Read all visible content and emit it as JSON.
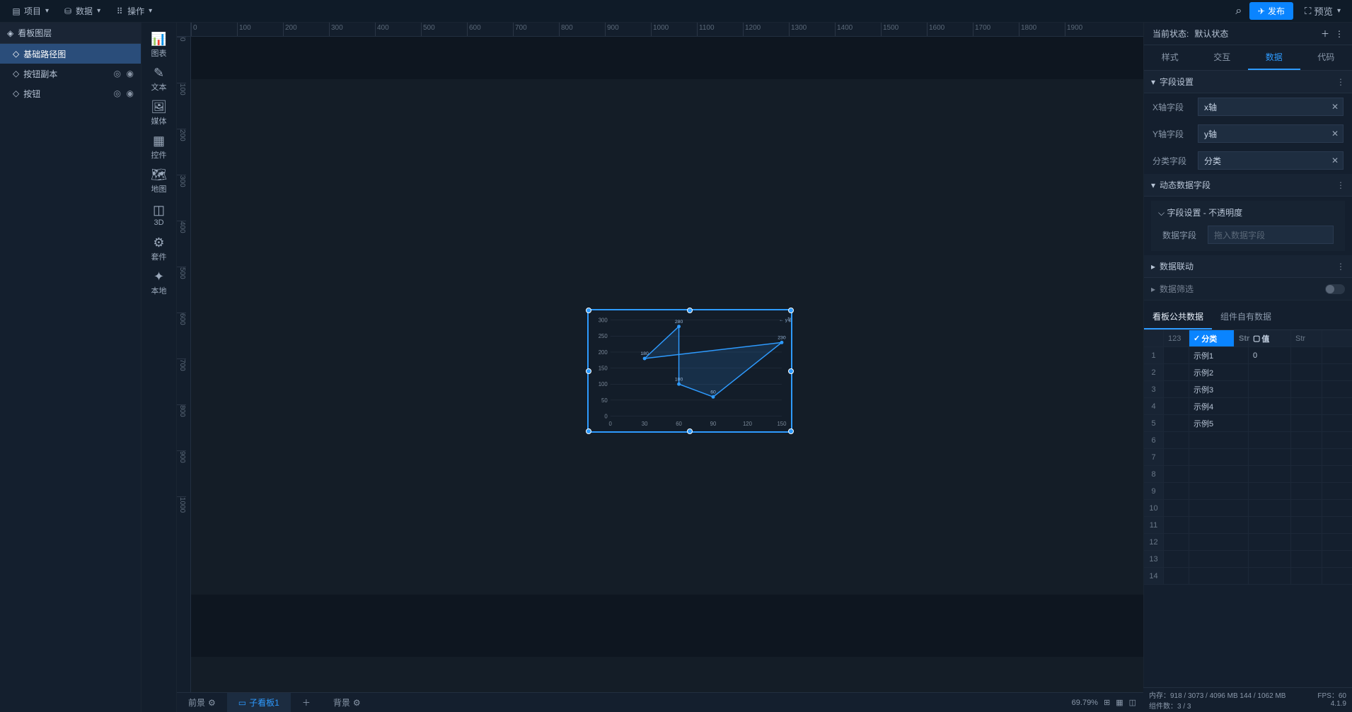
{
  "topMenu": {
    "project": "项目",
    "data": "数据",
    "operate": "操作"
  },
  "topRight": {
    "publish": "发布",
    "preview": "预览"
  },
  "leftPanel": {
    "title": "看板图层",
    "items": [
      {
        "label": "基础路径图",
        "active": true
      },
      {
        "label": "按钮副本",
        "active": false,
        "eye": true,
        "lock": true
      },
      {
        "label": "按钮",
        "active": false,
        "eye": true,
        "lock": true
      }
    ]
  },
  "compBar": [
    {
      "label": "图表",
      "icon": "📊"
    },
    {
      "label": "文本",
      "icon": "✎"
    },
    {
      "label": "媒体",
      "icon": "🖼"
    },
    {
      "label": "控件",
      "icon": "▦"
    },
    {
      "label": "地图",
      "icon": "🗺"
    },
    {
      "label": "3D",
      "icon": "◫"
    },
    {
      "label": "套件",
      "icon": "⚙"
    },
    {
      "label": "本地",
      "icon": "✦"
    }
  ],
  "ruler": {
    "h": [
      "0",
      "100",
      "200",
      "300",
      "400",
      "500",
      "600",
      "700",
      "800",
      "900",
      "1000",
      "1100",
      "1200",
      "1300",
      "1400",
      "1500",
      "1600",
      "1700",
      "1800",
      "1900"
    ],
    "v": [
      "0",
      "100",
      "200",
      "300",
      "400",
      "500",
      "600",
      "700",
      "800",
      "900",
      "1000"
    ]
  },
  "chart_data": {
    "type": "line",
    "series": [
      {
        "name": "y轴",
        "points": [
          {
            "x": 30,
            "y": 180
          },
          {
            "x": 60,
            "y": 280
          },
          {
            "x": 60,
            "y": 100
          },
          {
            "x": 90,
            "y": 60
          },
          {
            "x": 150,
            "y": 230
          }
        ]
      }
    ],
    "xlabel": "",
    "ylabel": "",
    "xticks": [
      0,
      30,
      60,
      90,
      120,
      150
    ],
    "yticks": [
      0,
      50,
      100,
      150,
      200,
      250,
      300
    ],
    "legend": "y轴"
  },
  "rightPanel": {
    "stateLabel": "当前状态:",
    "stateValue": "默认状态",
    "tabs": [
      "样式",
      "交互",
      "数据",
      "代码"
    ],
    "activeTab": 2,
    "fieldSection": "字段设置",
    "xAxisLabel": "X轴字段",
    "xAxisValue": "x轴",
    "yAxisLabel": "Y轴字段",
    "yAxisValue": "y轴",
    "catLabel": "分类字段",
    "catValue": "分类",
    "dynSection": "动态数据字段",
    "opacityLabel": "字段设置 - 不透明度",
    "dataFieldLabel": "数据字段",
    "dataFieldPlaceholder": "拖入数据字段",
    "linkSection": "数据联动",
    "filterSection": "数据筛选",
    "dataTabs": [
      "看板公共数据",
      "组件自有数据"
    ],
    "activeDataTab": 0,
    "gridHeaders": {
      "a": "123",
      "b": "分类",
      "c": "值",
      "d": "Str"
    },
    "gridLeft": "Str",
    "gridRows": [
      {
        "n": 1,
        "cat": "示例1",
        "val": "0"
      },
      {
        "n": 2,
        "cat": "示例2",
        "val": ""
      },
      {
        "n": 3,
        "cat": "示例3",
        "val": ""
      },
      {
        "n": 4,
        "cat": "示例4",
        "val": ""
      },
      {
        "n": 5,
        "cat": "示例5",
        "val": ""
      },
      {
        "n": 6,
        "cat": "",
        "val": ""
      },
      {
        "n": 7,
        "cat": "",
        "val": ""
      },
      {
        "n": 8,
        "cat": "",
        "val": ""
      },
      {
        "n": 9,
        "cat": "",
        "val": ""
      },
      {
        "n": 10,
        "cat": "",
        "val": ""
      },
      {
        "n": 11,
        "cat": "",
        "val": ""
      },
      {
        "n": 12,
        "cat": "",
        "val": ""
      },
      {
        "n": 13,
        "cat": "",
        "val": ""
      },
      {
        "n": 14,
        "cat": "",
        "val": ""
      }
    ]
  },
  "bottomTabs": {
    "front": "前景",
    "sub": "子看板1",
    "back": "背景"
  },
  "bottomRight": {
    "zoom": "69.79%"
  },
  "status": {
    "mem": "内存：918 / 3073 / 4096 MB  144 / 1062 MB",
    "fps": "FPS：60",
    "comp": "组件数：3 / 3",
    "ver": "4.1.9"
  }
}
